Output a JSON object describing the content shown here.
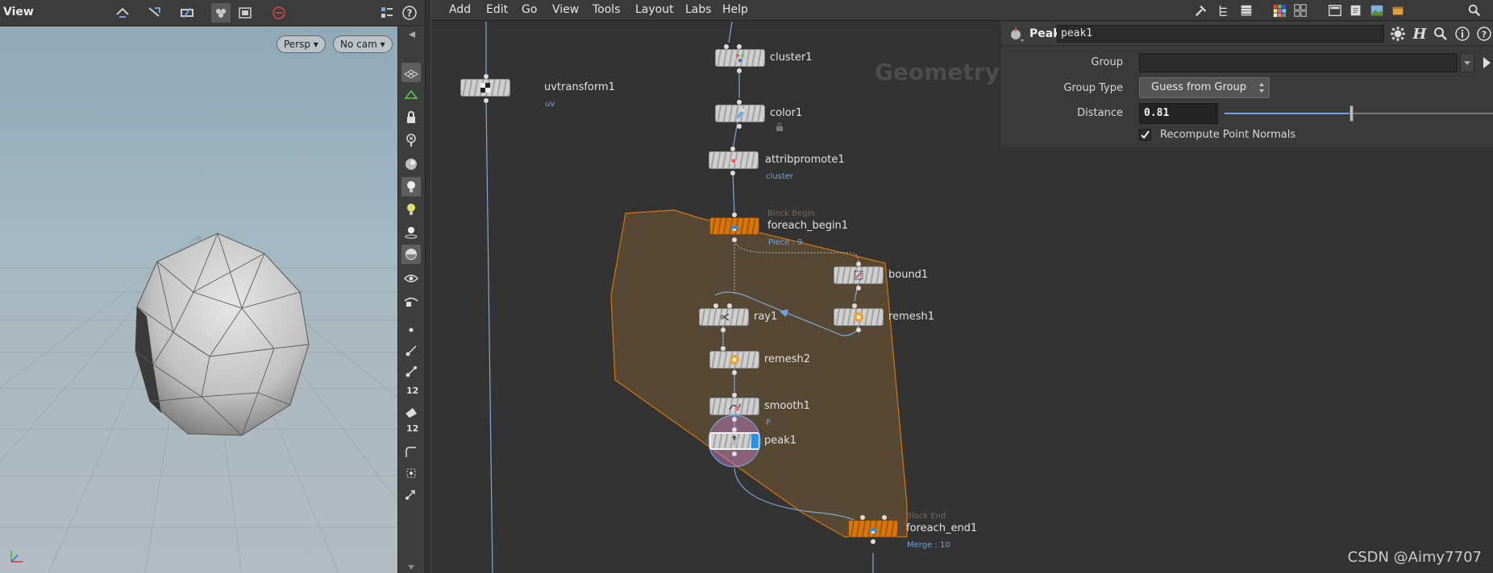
{
  "viewport": {
    "title": "View",
    "persp_label": "Persp",
    "cam_label": "No cam",
    "side_num_a": "12",
    "side_num_b": "12",
    "colors": {
      "sky_top": "#8fa9b7",
      "ground": "#b2bcc2"
    }
  },
  "menu": {
    "items": [
      "Add",
      "Edit",
      "Go",
      "View",
      "Tools",
      "Layout",
      "Labs",
      "Help"
    ]
  },
  "network": {
    "context_label": "Geometry",
    "nodes": {
      "uvtransform1": {
        "name": "uvtransform1",
        "sub": "uv"
      },
      "cluster1": {
        "name": "cluster1"
      },
      "color1": {
        "name": "color1"
      },
      "attribpromote1": {
        "name": "attribpromote1",
        "sub": "cluster"
      },
      "foreach_begin1": {
        "name": "foreach_begin1",
        "tag": "Block Begin",
        "sub": "Piece : 9"
      },
      "bound1": {
        "name": "bound1"
      },
      "ray1": {
        "name": "ray1"
      },
      "remesh1": {
        "name": "remesh1"
      },
      "remesh2": {
        "name": "remesh2"
      },
      "smooth1": {
        "name": "smooth1",
        "sub": "P"
      },
      "peak1": {
        "name": "peak1"
      },
      "foreach_end1": {
        "name": "foreach_end1",
        "tag": "Block End",
        "sub": "Merge : 10"
      }
    },
    "colors": {
      "block_region": "#d8760c",
      "wire": "#7fa8d8",
      "selected_node": "#c67ed0"
    }
  },
  "params": {
    "node_type": "Peak",
    "node_name": "peak1",
    "group_label": "Group",
    "group_value": "",
    "group_type_label": "Group Type",
    "group_type_value": "Guess from Group",
    "distance_label": "Distance",
    "distance_value": "0.81",
    "distance_fraction": 0.47,
    "recompute_label": "Recompute Point Normals",
    "recompute_checked": true
  },
  "watermark": "CSDN @Aimy7707"
}
